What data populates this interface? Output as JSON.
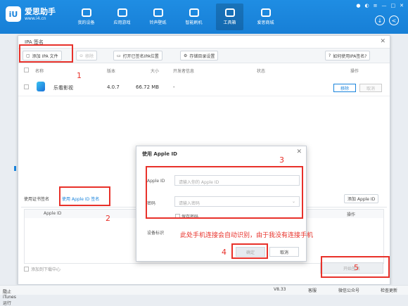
{
  "app": {
    "name": "爱思助手",
    "url": "www.i4.cn"
  },
  "nav": [
    {
      "label": "我的设备",
      "icon": "apple-icon"
    },
    {
      "label": "应用游戏",
      "icon": "apps-icon"
    },
    {
      "label": "铃声壁纸",
      "icon": "music-icon"
    },
    {
      "label": "智能刷机",
      "icon": "flash-icon"
    },
    {
      "label": "工具箱",
      "icon": "toolbox-icon"
    },
    {
      "label": "爱思商城",
      "icon": "shop-icon"
    }
  ],
  "window_controls": {
    "icons": [
      "user-icon",
      "skin-icon",
      "menu-icon",
      "minimize-icon",
      "maximize-icon",
      "close-icon"
    ],
    "download": "↓",
    "back": "<"
  },
  "dialog": {
    "title": "IPA 签名",
    "toolbar": {
      "add_ipa": "添加 IPA 文件",
      "remove": "移除",
      "open_folder": "打开已签名IPA位置",
      "storage_settings": "存储目录设置",
      "how_to": "如何使用IPA签名?"
    },
    "table_headers": {
      "name": "名称",
      "version": "版本",
      "size": "大小",
      "developer": "开发者信息",
      "status": "状态",
      "action": "操作"
    },
    "rows": [
      {
        "name": "乐看影视",
        "version": "4.0.7",
        "size": "66.72 MB",
        "developer": "-",
        "action_remove": "移除",
        "action_cancel": "取消"
      }
    ],
    "lower_tabs": {
      "cert": "使用证书签名",
      "appleid": "使用 Apple ID 签名",
      "add_appleid": "添加 Apple ID"
    },
    "lower_headers": {
      "appleid": "Apple ID",
      "action": "操作"
    },
    "bottom_check": "添加到下载中心",
    "start_sign": "开始签名"
  },
  "modal": {
    "title": "使用 Apple ID",
    "appleid_label": "Apple ID",
    "appleid_placeholder": "请输入你的 Apple ID",
    "password_label": "密码",
    "password_placeholder": "请输入密码",
    "save_password": "保存密码",
    "device_label": "设备标识",
    "confirm": "确定",
    "cancel": "取消",
    "annotation": "此处手机连接会自动识别，由于我没有连接手机"
  },
  "annotation_numbers": [
    "1",
    "2",
    "3",
    "4",
    "5"
  ],
  "statusbar": {
    "itunes": "阻止iTunes运行",
    "version": "V8.33",
    "feedback": "客服",
    "wechat": "微信公众号",
    "check_update": "检查更新"
  },
  "colors": {
    "primary": "#1a84dc",
    "annotation_red": "#e8312a"
  }
}
